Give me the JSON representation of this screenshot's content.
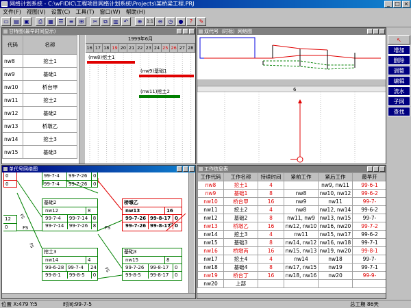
{
  "app": {
    "title": "网络计划系统 - C:\\wFIDIC\\工程项目网络计划系统\\Projects\\某桥梁工程.PRJ"
  },
  "menu": [
    "文件(F)",
    "视图(V)",
    "设置(C)",
    "工具(T)",
    "窗口(W)",
    "帮助(H)"
  ],
  "toolbar": [
    "new",
    "open",
    "save",
    "print",
    "grid",
    "table",
    "gantt",
    "net",
    "cut",
    "copy",
    "paste",
    "undo",
    "zoom-in",
    "one",
    "zoom-out",
    "time",
    "globe",
    "help",
    "brush"
  ],
  "toolbar_labels": {
    "one": "1:1"
  },
  "gantt_window": {
    "title": "甘特图(最早时间显示)",
    "col_code": "代码",
    "col_name": "名称",
    "month_label": "1999年6月",
    "days": [
      "16",
      "17",
      "18",
      "19",
      "20",
      "21",
      "22",
      "23",
      "24",
      "25",
      "26",
      "27",
      "28"
    ],
    "red_days": [
      "19",
      "25",
      "26"
    ],
    "rows": [
      {
        "code": "nw8",
        "name": "挖土1"
      },
      {
        "code": "nw9",
        "name": "基础1"
      },
      {
        "code": "nw10",
        "name": "桥台甲"
      },
      {
        "code": "nw11",
        "name": "挖土2"
      },
      {
        "code": "nw12",
        "name": "基础2"
      },
      {
        "code": "nw13",
        "name": "桥墩乙"
      },
      {
        "code": "nw14",
        "name": "挖土3"
      },
      {
        "code": "nw15",
        "name": "基础3"
      }
    ],
    "bars": [
      {
        "label": "(nw8)挖土1",
        "color": "#e00000"
      },
      {
        "label": "(nw9)基础1",
        "color": "#e00000"
      },
      {
        "label": "(nw11)挖土2",
        "color": "#008000"
      }
    ]
  },
  "dual_window": {
    "title": "双代号（时标）网络图",
    "col_label": "6"
  },
  "right_panel": [
    "增加",
    "删除",
    "调整",
    "编辑",
    "流水",
    "子网",
    "查找"
  ],
  "single_window": {
    "title": "单代号网络图",
    "link_fs": "FS",
    "top_row_left": [
      "0",
      "99-7-4",
      "99-7-26",
      "0"
    ],
    "top_row_left2": [
      "0",
      "99-7-4",
      "99-7-26",
      "0"
    ],
    "side_nums": [
      "12",
      "0"
    ],
    "nodes": [
      {
        "name": "基础2",
        "code": "nw12",
        "dur": "8",
        "r1": [
          "99-7-4",
          "99-7-14",
          "8"
        ],
        "r2": [
          "99-7-14",
          "99-7-26",
          "8"
        ],
        "red": false
      },
      {
        "name": "桥墩乙",
        "code": "nw13",
        "dur": "16",
        "r1": [
          "99-7-26",
          "99-8-17",
          "0"
        ],
        "r2": [
          "99-7-26",
          "99-8-17",
          "0"
        ],
        "red": true
      },
      {
        "name": "挖土3",
        "code": "nw14",
        "dur": "4",
        "r1": [
          "99-6-28",
          "99-7-4",
          "24"
        ],
        "r2": [
          "99-8-1",
          "99-8-5",
          "0"
        ],
        "red": false
      },
      {
        "name": "基础3",
        "code": "nw15",
        "dur": "8",
        "r1": [
          "99-7-26",
          "99-8-17",
          "0"
        ],
        "r2": [
          "99-8-5",
          "99-8-17",
          "0"
        ],
        "red": false
      }
    ]
  },
  "info_window": {
    "title": "工作信息表",
    "headers": [
      "工作代码",
      "工作名称",
      "持续时间",
      "紧前工作",
      "紧后工作",
      "最早开"
    ],
    "rows": [
      {
        "code": "nw8",
        "name": "挖土1",
        "dur": "4",
        "pre": "",
        "post": "nw9, nw11",
        "es": "99-6-1",
        "red": true
      },
      {
        "code": "nw9",
        "name": "基础1",
        "dur": "8",
        "pre": "nw8",
        "post": "nw10, nw12",
        "es": "99-6-2",
        "red": true
      },
      {
        "code": "nw10",
        "name": "桥台甲",
        "dur": "16",
        "pre": "nw9",
        "post": "nw11",
        "es": "99-7-",
        "red": true
      },
      {
        "code": "nw11",
        "name": "挖土2",
        "dur": "4",
        "pre": "nw8",
        "post": "nw12, nw14",
        "es": "99-6-2",
        "red": false
      },
      {
        "code": "nw12",
        "name": "基础2",
        "dur": "8",
        "pre": "nw11, nw9",
        "post": "nw13, nw15",
        "es": "99-7-",
        "red": false
      },
      {
        "code": "nw13",
        "name": "桥墩乙",
        "dur": "16",
        "pre": "nw12, nw10",
        "post": "nw16, nw20",
        "es": "99-7-2",
        "red": true
      },
      {
        "code": "nw14",
        "name": "挖土3",
        "dur": "4",
        "pre": "nw11",
        "post": "nw15, nw17",
        "es": "99-6-2",
        "red": false
      },
      {
        "code": "nw15",
        "name": "基础3",
        "dur": "8",
        "pre": "nw14, nw12",
        "post": "nw16, nw18",
        "es": "99-7-1",
        "red": false
      },
      {
        "code": "nw16",
        "name": "桥墩丙",
        "dur": "16",
        "pre": "nw15, nw13",
        "post": "nw19, nw20",
        "es": "99-8-1",
        "red": true
      },
      {
        "code": "nw17",
        "name": "挖土4",
        "dur": "4",
        "pre": "nw14",
        "post": "nw18",
        "es": "99-7-",
        "red": false
      },
      {
        "code": "nw18",
        "name": "基础4",
        "dur": "8",
        "pre": "nw17, nw15",
        "post": "nw19",
        "es": "99-7-1",
        "red": false
      },
      {
        "code": "nw19",
        "name": "桥台丁",
        "dur": "16",
        "pre": "nw18, nw16",
        "post": "nw20",
        "es": "99-9-",
        "red": true
      },
      {
        "code": "nw20",
        "name": "上部",
        "dur": "",
        "pre": "",
        "post": "",
        "es": "",
        "red": false
      }
    ]
  },
  "status": {
    "position": "位置 X:479 Y:5",
    "time": "时间:99-7-5",
    "total": "总工期 86天"
  }
}
